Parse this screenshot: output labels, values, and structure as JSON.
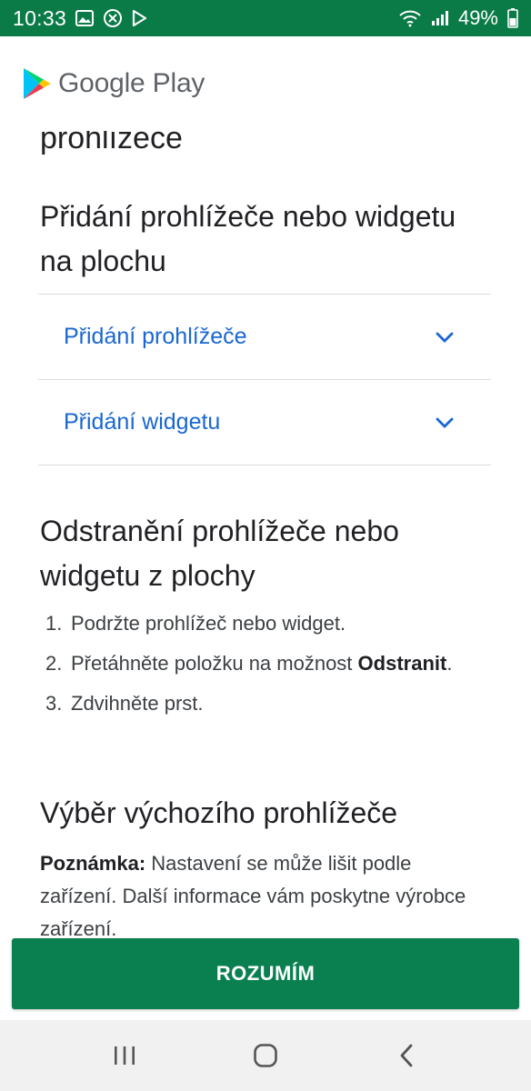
{
  "status_bar": {
    "time": "10:33",
    "battery_percent": "49%",
    "icons_left": [
      "image-icon",
      "close-circle-icon",
      "play-store-notification-icon"
    ],
    "icons_right": [
      "wifi-icon",
      "signal-icon",
      "battery-icon"
    ]
  },
  "header": {
    "brand": "Google Play"
  },
  "content": {
    "cut_heading": "prohlížeče",
    "section_add": {
      "title": "Přidání prohlížeče nebo widgetu na plochu",
      "accordion": [
        {
          "label": "Přidání prohlížeče",
          "icon": "chevron-down-icon"
        },
        {
          "label": "Přidání widgetu",
          "icon": "chevron-down-icon"
        }
      ]
    },
    "section_remove": {
      "title": "Odstranění prohlížeče nebo widgetu z plochy",
      "steps": [
        {
          "num": "1.",
          "text": "Podržte prohlížeč nebo widget."
        },
        {
          "num": "2.",
          "text_before": "Přetáhněte položku na možnost",
          "bold": "Odstranit",
          "text_after": "."
        },
        {
          "num": "3.",
          "text": "Zdvihněte prst."
        }
      ]
    },
    "section_default": {
      "title": "Výběr výchozího prohlížeče",
      "note_label": "Poznámka:",
      "note_text": " Nastavení se může lišit podle zařízení. Další informace vám poskytne výrobce zařízení."
    }
  },
  "action_button": {
    "label": "ROZUMÍM"
  },
  "navigation": {
    "recent": "recent-apps-icon",
    "home": "home-icon",
    "back": "back-icon"
  },
  "colors": {
    "status_bar": "#0a7a47",
    "button": "#0a8050",
    "link": "#1967d2"
  }
}
